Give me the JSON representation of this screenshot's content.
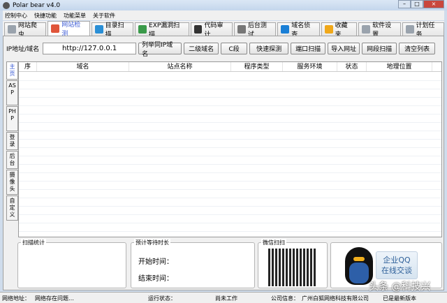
{
  "window": {
    "title": "Polar bear v4.0",
    "min": "–",
    "max": "□",
    "close": "×"
  },
  "menu": [
    "控制中心",
    "快捷功能",
    "功能菜单",
    "关于软件"
  ],
  "tabs": [
    {
      "label": "网站爬虫",
      "color": "#9aa3ad"
    },
    {
      "label": "网站检测",
      "color": "#e0553a"
    },
    {
      "label": "目录扫描",
      "color": "#2a8fd6"
    },
    {
      "label": "EXP漏洞扫描",
      "color": "#3a9a4a"
    },
    {
      "label": "代码审计",
      "color": "#333333"
    },
    {
      "label": "后台测试",
      "color": "#777777"
    },
    {
      "label": "域名侦查",
      "color": "#1a7fd6"
    },
    {
      "label": "收藏夹",
      "color": "#f0a81a"
    },
    {
      "label": "软件设置",
      "color": "#9aa3ad"
    },
    {
      "label": "计划任务",
      "color": "#9aa3ad"
    }
  ],
  "input": {
    "label": "IP地址/域名",
    "value": "http://127.0.0.1"
  },
  "buttons": [
    "列举同IP域名",
    "二级域名",
    "C段",
    "快速探测",
    "端口扫描",
    "导入网址",
    "网段扫描",
    "清空列表"
  ],
  "side_tabs": [
    "主页",
    "ASP",
    "PHP",
    "登录",
    "后台",
    "摄像头",
    "自定义"
  ],
  "columns": [
    "序",
    "域名",
    "站点名称",
    "程序类型",
    "服务环境",
    "状态",
    "地理位置"
  ],
  "scan_stats": {
    "title": "扫描统计"
  },
  "eta": {
    "title": "预计等待时长",
    "start_label": "开始时间：",
    "end_label": "结束时间："
  },
  "wechat": {
    "title": "微信扫扫"
  },
  "qq": {
    "line1": "企业QQ",
    "line2": "在线交谈"
  },
  "status": {
    "net_label": "网络地址：",
    "net_value": "网络存在问题…",
    "run_label": "运行状态：",
    "run_value": "尚未工作",
    "company_label": "公司信息：",
    "company_value": "广州白狐网络科技有限公司",
    "version": "已是最新版本"
  },
  "watermark": "头条 @科技兴"
}
